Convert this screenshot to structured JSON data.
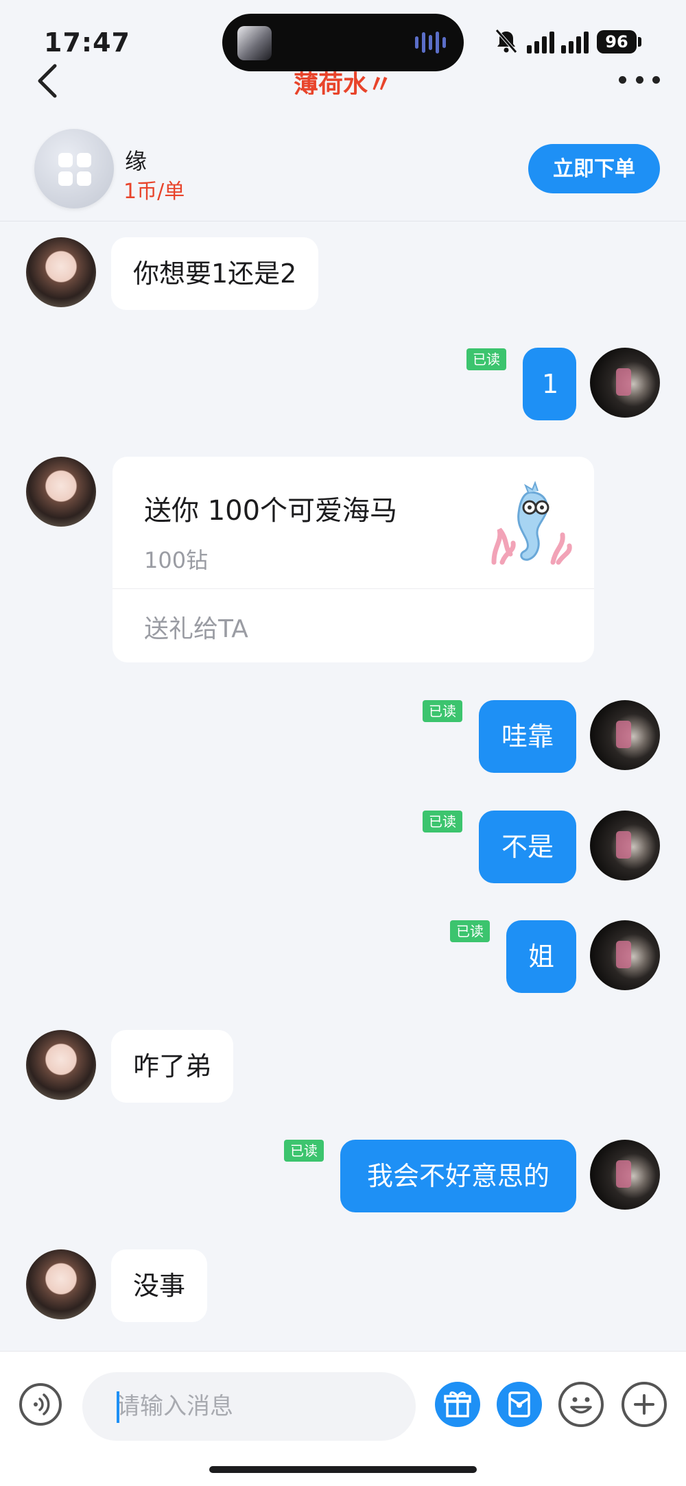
{
  "status_bar": {
    "time": "17:47",
    "battery": "96"
  },
  "nav": {
    "title": "薄荷水〃"
  },
  "service": {
    "name": "缘",
    "price": "1币/单",
    "order_button": "立即下单"
  },
  "read_label": "已读",
  "messages": [
    {
      "side": "in",
      "text": "你想要1还是2"
    },
    {
      "side": "out",
      "text": "1",
      "status": "已读"
    },
    {
      "side": "in",
      "type": "gift",
      "title": "送你 100个可爱海马",
      "price": "100钻",
      "action": "送礼给TA"
    },
    {
      "side": "out",
      "text": "哇靠",
      "status": "已读"
    },
    {
      "side": "out",
      "text": "不是",
      "status": "已读"
    },
    {
      "side": "out",
      "text": "姐",
      "status": "已读"
    },
    {
      "side": "in",
      "text": "咋了弟"
    },
    {
      "side": "out",
      "text": "我会不好意思的",
      "status": "已读"
    },
    {
      "side": "in",
      "text": "没事"
    }
  ],
  "input": {
    "placeholder": "请输入消息"
  },
  "colors": {
    "accent": "#1e90f5",
    "price_red": "#e8442b",
    "read_green": "#3cc46e"
  },
  "icons": [
    "back-icon",
    "more-icon",
    "mute-icon",
    "voice-icon",
    "gift-icon",
    "red-packet-icon",
    "emoji-icon",
    "plus-icon"
  ]
}
